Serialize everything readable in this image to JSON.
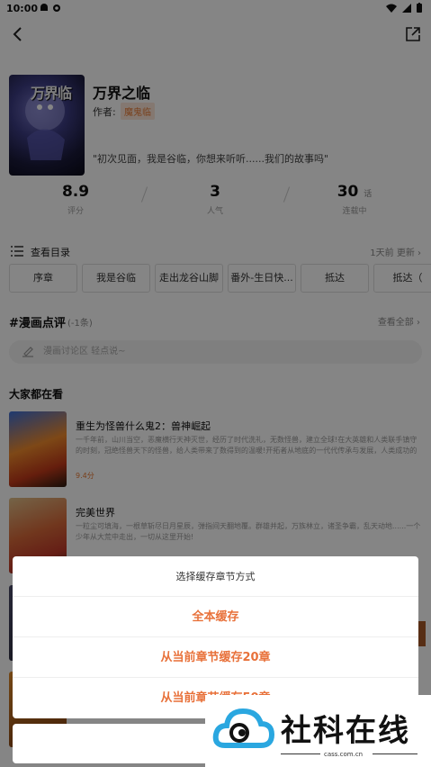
{
  "status": {
    "time": "10:00"
  },
  "comic": {
    "title": "万界之临",
    "author_label": "作者:",
    "author": "魔鬼临",
    "cover_text": "万界临",
    "quote": "\"初次见面，我是谷临，你想来听听......我们的故事吗\""
  },
  "stats": [
    {
      "value": "8.9",
      "unit": "",
      "label": "评分"
    },
    {
      "value": "3",
      "unit": "",
      "label": "人气"
    },
    {
      "value": "30",
      "unit": "话",
      "label": "连载中"
    }
  ],
  "toc": {
    "label": "查看目录",
    "updated": "1天前 更新 ›",
    "chapters": [
      "序章",
      "我是谷临",
      "走出龙谷山脚",
      "番外-生日快...",
      "抵达",
      "抵达（"
    ]
  },
  "comments": {
    "title": "#漫画点评",
    "count": "(-1条)",
    "view_all": "查看全部 ›",
    "placeholder": "漫画讨论区 轻点说~"
  },
  "recommend": {
    "title": "大家都在看",
    "items": [
      {
        "name": "重生为怪兽什么鬼2：兽神崛起",
        "desc": "一千年前，山川当空，恶魔横行天神灭世，经历了时代洗礼，无数怪兽，建立全球!在大英雄和人类联手镇守的时刻，冠绝怪兽天下的怪兽，给人类带来了数得到的温暖!开拓者从地底的一代代传承与发展，人类成功的进出...",
        "score": "9.4分"
      },
      {
        "name": "完美世界",
        "desc": "一粒尘可填海，一根草斩尽日月星辰，弹指间天翻地覆。群雄并起，万族林立，诸圣争霸，乱天动地......一个少年从大荒中走出，一切从这里开始!",
        "score": ""
      }
    ]
  },
  "sheet": {
    "header": "选择缓存章节方式",
    "options": [
      "全本缓存",
      "从当前章节缓存20章",
      "从当前章节缓存50章"
    ]
  },
  "watermark": {
    "text": "社科在线",
    "url": "cass.com.cn"
  },
  "colors": {
    "accent": "#e8713a",
    "overlay": "rgba(0,0,0,0.48)"
  }
}
